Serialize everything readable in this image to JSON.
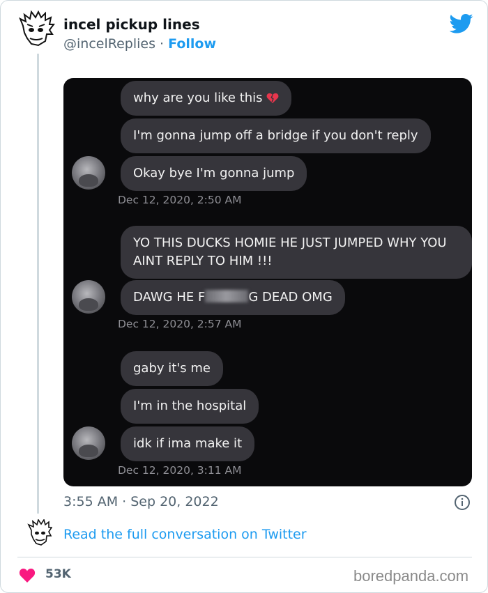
{
  "tweet": {
    "author_name": "incel pickup lines",
    "handle": "@incelReplies",
    "separator": "·",
    "follow_label": "Follow",
    "time": "3:55 AM · Sep 20, 2022",
    "read_link": "Read the full conversation on Twitter",
    "like_count": "53K",
    "like_color": "#f91880",
    "accent_color": "#1d9bf0",
    "icons": [
      "twitter-bird-icon",
      "info-icon",
      "heart-icon"
    ]
  },
  "screenshot": {
    "messages": [
      {
        "text": "why are you like this",
        "emoji": "broken-heart-icon"
      },
      {
        "text": "I'm gonna jump off a bridge if you don't reply"
      },
      {
        "text": "Okay bye I'm gonna jump"
      },
      {
        "timestamp": "Dec 12, 2020, 2:50 AM"
      },
      {
        "text": "YO THIS DUCKS HOMIE HE JUST JUMPED WHY YOU AINT REPLY TO HIM !!!"
      },
      {
        "text_before": "DAWG HE F",
        "text_after": "G DEAD OMG"
      },
      {
        "timestamp": "Dec 12, 2020, 2:57 AM"
      },
      {
        "text": "gaby it's me"
      },
      {
        "text": "I'm in the hospital"
      },
      {
        "text": "idk if ima make it"
      },
      {
        "timestamp": "Dec 12, 2020, 3:11 AM"
      }
    ]
  },
  "footer": {
    "watermark": "boredpanda.com"
  }
}
